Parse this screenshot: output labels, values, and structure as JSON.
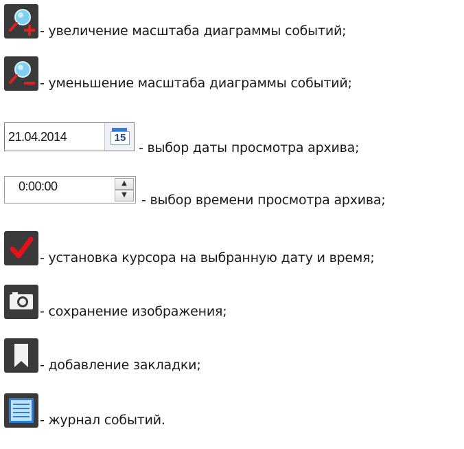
{
  "items": [
    {
      "icon": "zoom-in-icon",
      "text": "- увеличение масштаба диаграммы событий;"
    },
    {
      "icon": "zoom-out-icon",
      "text": "- уменьшение масштаба диаграммы событий;"
    },
    {
      "icon": "calendar-icon",
      "text": "- выбор даты просмотра архива;",
      "date_value": "21.04.2014",
      "calendar_day": "15"
    },
    {
      "icon": "time-spinner",
      "text": "- выбор времени просмотра архива;",
      "time_value": "0:00:00",
      "spin_up": "▲",
      "spin_down": "▼"
    },
    {
      "icon": "checkmark-icon",
      "text": "- установка курсора на выбранную дату и время;"
    },
    {
      "icon": "camera-icon",
      "text": "- сохранение изображения;"
    },
    {
      "icon": "bookmark-icon",
      "text": "- добавление закладки;"
    },
    {
      "icon": "list-icon",
      "text": "- журнал событий."
    }
  ],
  "colors": {
    "icon_bg": "#3a3a3a",
    "zoom_plus": "#e02020",
    "zoom_minus": "#e02020",
    "lens": "#7fd0f0",
    "check": "#e8101a",
    "list_bg": "#2d7fd4"
  }
}
